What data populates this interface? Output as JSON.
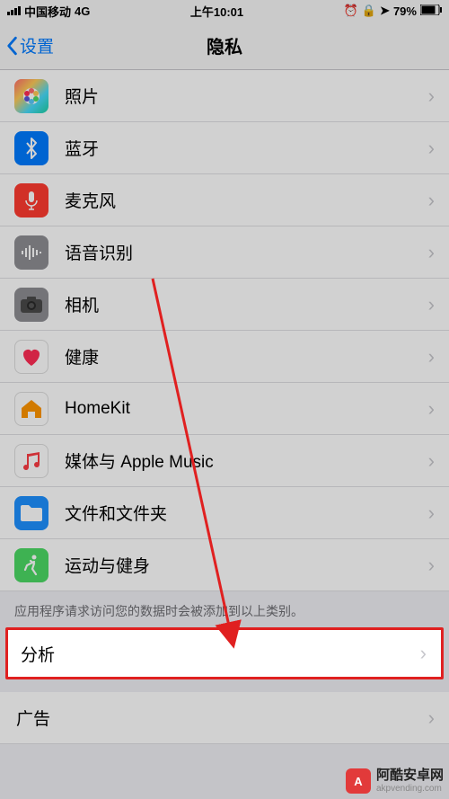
{
  "status": {
    "carrier": "中国移动",
    "network": "4G",
    "time": "上午10:01",
    "battery": "79%"
  },
  "nav": {
    "back": "设置",
    "title": "隐私"
  },
  "rows": [
    {
      "label": "照片",
      "iconBg": "linear-gradient(135deg,#ff6b6b,#feca57,#48dbfb,#1dd1a1)",
      "name": "photos"
    },
    {
      "label": "蓝牙",
      "iconBg": "#007aff",
      "name": "bluetooth"
    },
    {
      "label": "麦克风",
      "iconBg": "#ff3b30",
      "name": "microphone"
    },
    {
      "label": "语音识别",
      "iconBg": "#8e8e93",
      "name": "speech-recognition"
    },
    {
      "label": "相机",
      "iconBg": "#8e8e93",
      "name": "camera"
    },
    {
      "label": "健康",
      "iconBg": "#ffffff",
      "name": "health"
    },
    {
      "label": "HomeKit",
      "iconBg": "#ffffff",
      "name": "homekit"
    },
    {
      "label": "媒体与 Apple Music",
      "iconBg": "#ffffff",
      "name": "media-music"
    },
    {
      "label": "文件和文件夹",
      "iconBg": "#1e90ff",
      "name": "files-folders"
    },
    {
      "label": "运动与健身",
      "iconBg": "#4cd964",
      "name": "motion-fitness"
    }
  ],
  "footer": "应用程序请求访问您的数据时会被添加到以上类别。",
  "group2": [
    {
      "label": "分析",
      "name": "analytics"
    },
    {
      "label": "广告",
      "name": "advertising"
    }
  ],
  "watermark": {
    "title": "阿酷安卓网",
    "url": "akpvending.com"
  }
}
